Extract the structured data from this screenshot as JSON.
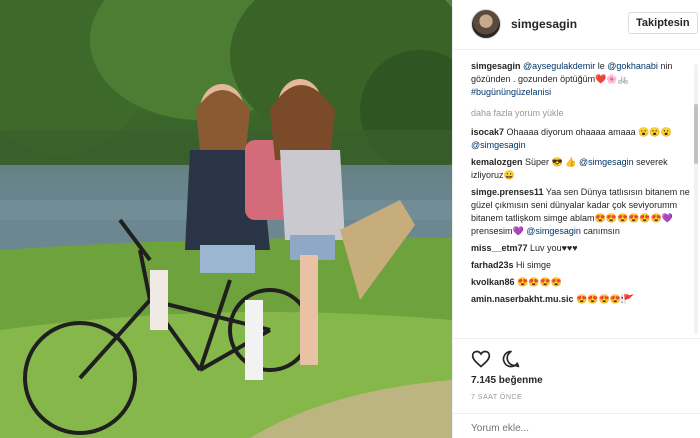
{
  "post": {
    "author": "simgesagin",
    "follow_label": "Takiptesin",
    "caption": {
      "user": "simgesagin",
      "mention1": "@aysegulakdemir",
      "text1": " le ",
      "mention2": "@gokhanabi",
      "text2": " nin gözünden . gozunden öptüğüm❤️🌸🚲 ",
      "hashtag": "#bugününgüzelanisi"
    },
    "load_more": "daha fazla yorum yükle",
    "comments": [
      {
        "user": "isocak7",
        "text": " Ohaaaa diyorum ohaaaa amaaa 😮😮😮 ",
        "mention": "@simgesagin",
        "text_after": ""
      },
      {
        "user": "kemalozgen",
        "text": " Süper 😎 👍 ",
        "mention": "@simgesagin",
        "text_after": " severek izliyoruz😀"
      },
      {
        "user": "simge.prenses11",
        "text": " Yaa sen Dünya tatlısısın bitanem ne güzel çıkmısın seni dünyalar kadar çok seviyorumm bitanem tatlişkom simge ablam😍😍😍😍😍😍💜prensesim💜 ",
        "mention": "@simgesagin",
        "text_after": " canımsın"
      },
      {
        "user": "miss__etm77",
        "text": " Luv you♥♥♥",
        "mention": "",
        "text_after": ""
      },
      {
        "user": "farhad23s",
        "text": " Hi simge",
        "mention": "",
        "text_after": ""
      },
      {
        "user": "kvolkan86",
        "text": " 😍😍😍😍",
        "mention": "",
        "text_after": ""
      },
      {
        "user": "amin.naserbakht.mu.sic",
        "text": " 😍😍😍😍🕯🚩",
        "mention": "",
        "text_after": ""
      }
    ],
    "likes": "7.145 beğenme",
    "time": "7 SAAT ÖNCE",
    "comment_placeholder": "Yorum ekle..."
  },
  "colors": {
    "link": "#003569",
    "muted": "#999999",
    "border": "#efefef"
  },
  "icons": {
    "like": "heart-icon",
    "comment": "comment-bubble-icon"
  }
}
